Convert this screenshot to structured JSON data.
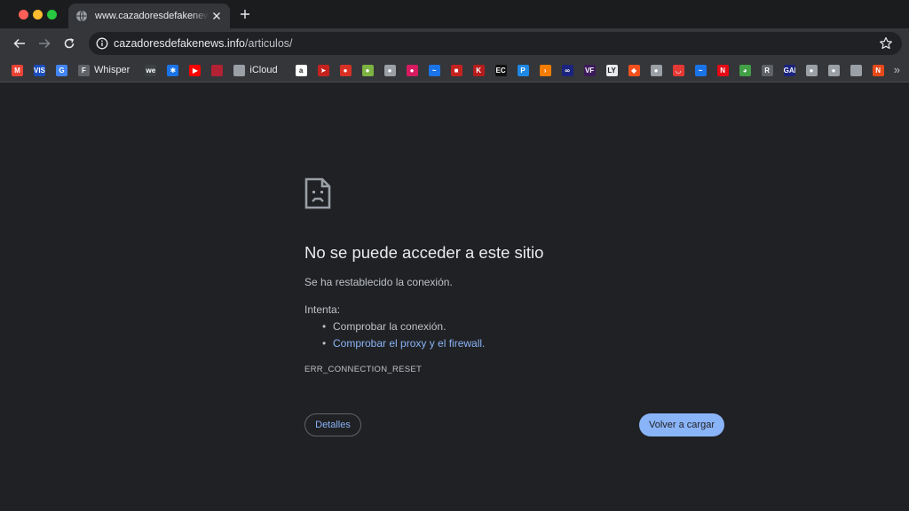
{
  "tab": {
    "title": "www.cazadoresdefakenews.info/articulos/",
    "favicon": "globe-icon"
  },
  "omnibox": {
    "host": "cazadoresdefakenews.info",
    "path": "/articulos/"
  },
  "bookmarks": [
    {
      "icon": "gmail-icon",
      "label": "",
      "glyph": "M",
      "color": "#ea4335"
    },
    {
      "icon": "visa-icon",
      "label": "",
      "glyph": "VISA",
      "color": "#1a4dbd"
    },
    {
      "icon": "google-icon",
      "label": "",
      "glyph": "G",
      "color": "#4285f4"
    },
    {
      "icon": "whisper-icon",
      "label": "Whisper",
      "glyph": "F",
      "color": "#5f6368"
    },
    {
      "icon": "we-icon",
      "label": "",
      "glyph": "we",
      "color": "#3c4043"
    },
    {
      "icon": "accessibility-icon",
      "label": "",
      "glyph": "✱",
      "color": "#1a73e8"
    },
    {
      "icon": "youtube-icon",
      "label": "",
      "glyph": "▶",
      "color": "#ff0000"
    },
    {
      "icon": "us-flag-icon",
      "label": "",
      "glyph": "",
      "color": "#b22234"
    },
    {
      "icon": "apple-icon",
      "label": "iCloud",
      "glyph": "",
      "color": "#9aa0a6"
    },
    {
      "icon": "amazon-icon",
      "label": "",
      "glyph": "a",
      "color": "#ffffff"
    },
    {
      "icon": "red-arrow-icon",
      "label": "",
      "glyph": "➤",
      "color": "#c5221f"
    },
    {
      "icon": "crab-icon",
      "label": "",
      "glyph": "●",
      "color": "#d93025"
    },
    {
      "icon": "leaf-icon",
      "label": "",
      "glyph": "●",
      "color": "#7cb342"
    },
    {
      "icon": "globe-icon",
      "label": "",
      "glyph": "●",
      "color": "#9aa0a6"
    },
    {
      "icon": "pink-icon",
      "label": "",
      "glyph": "●",
      "color": "#d81b60"
    },
    {
      "icon": "blue-text-icon",
      "label": "",
      "glyph": "~",
      "color": "#1a73e8"
    },
    {
      "icon": "red-square-icon",
      "label": "",
      "glyph": "■",
      "color": "#c5221f"
    },
    {
      "icon": "k-icon",
      "label": "",
      "glyph": "K",
      "color": "#b71c1c"
    },
    {
      "icon": "ec-icon",
      "label": "",
      "glyph": "EC",
      "color": "#111111"
    },
    {
      "icon": "p-icon",
      "label": "",
      "glyph": "P",
      "color": "#1e88e5"
    },
    {
      "icon": "orange-icon",
      "label": "",
      "glyph": "›",
      "color": "#f57c00"
    },
    {
      "icon": "dark-blue-icon",
      "label": "",
      "glyph": "∞",
      "color": "#1a237e"
    },
    {
      "icon": "vf-icon",
      "label": "",
      "glyph": "VF",
      "color": "#3c1a5b"
    },
    {
      "icon": "ly-icon",
      "label": "",
      "glyph": "LY",
      "color": "#e8eaed"
    },
    {
      "icon": "flame-icon",
      "label": "",
      "glyph": "◆",
      "color": "#f4511e"
    },
    {
      "icon": "globe-icon",
      "label": "",
      "glyph": "●",
      "color": "#9aa0a6"
    },
    {
      "icon": "watermelon-icon",
      "label": "",
      "glyph": "◡",
      "color": "#e53935"
    },
    {
      "icon": "blue-text-icon",
      "label": "",
      "glyph": "~",
      "color": "#1a73e8"
    },
    {
      "icon": "netflix-icon",
      "label": "",
      "glyph": "N",
      "color": "#e50914"
    },
    {
      "icon": "green-icon",
      "label": "",
      "glyph": "◕",
      "color": "#43a047"
    },
    {
      "icon": "r-icon",
      "label": "",
      "glyph": "R",
      "color": "#5f6368"
    },
    {
      "icon": "gap-icon",
      "label": "",
      "glyph": "GAP",
      "color": "#1a237e"
    },
    {
      "icon": "globe-icon",
      "label": "",
      "glyph": "●",
      "color": "#9aa0a6"
    },
    {
      "icon": "globe-icon",
      "label": "",
      "glyph": "●",
      "color": "#9aa0a6"
    },
    {
      "icon": "apple-icon",
      "label": "",
      "glyph": "",
      "color": "#9aa0a6"
    },
    {
      "icon": "n-icon",
      "label": "",
      "glyph": "N",
      "color": "#e64a19"
    }
  ],
  "error": {
    "icon": "sad-document-icon",
    "title": "No se puede acceder a este sitio",
    "description": "Se ha restablecido la conexión.",
    "try_label": "Intenta:",
    "suggestions": [
      {
        "text": "Comprobar la conexión.",
        "link": false
      },
      {
        "text": "Comprobar el proxy y el firewall.",
        "link": true
      }
    ],
    "code": "ERR_CONNECTION_RESET",
    "details_button": "Detalles",
    "reload_button": "Volver a cargar"
  },
  "colors": {
    "page_bg": "#202124",
    "toolbar_bg": "#35363a",
    "link": "#8ab4f8"
  }
}
